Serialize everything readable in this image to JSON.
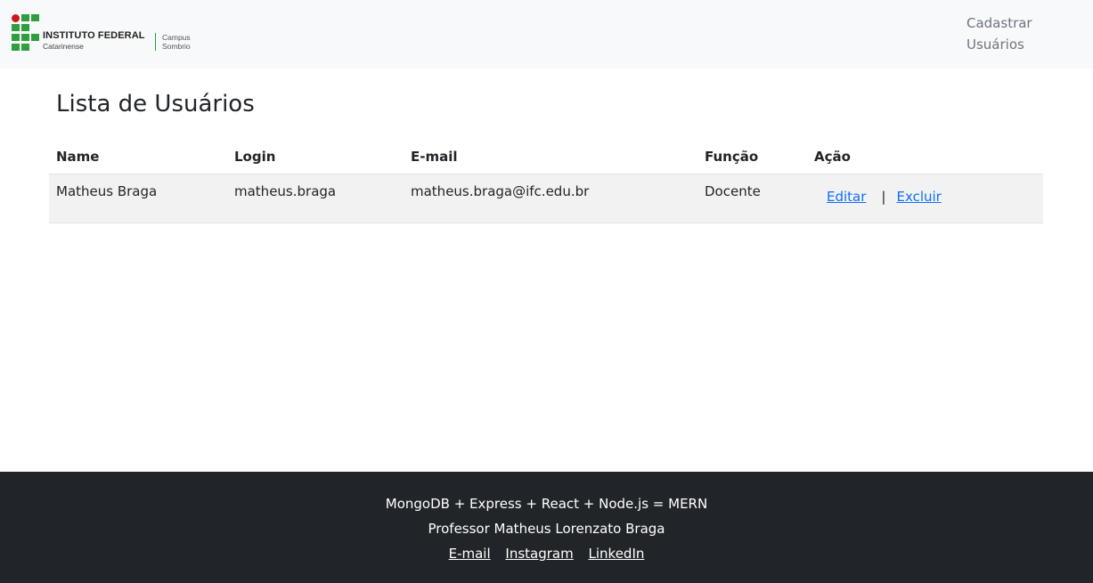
{
  "navbar": {
    "logo": {
      "name": "INSTITUTO FEDERAL",
      "subname": "Catarinense",
      "campus_line1": "Campus",
      "campus_line2": "Sombrio"
    },
    "nav_link_label": "Cadastrar Usuários"
  },
  "main": {
    "title": "Lista de Usuários",
    "table": {
      "headers": [
        "Name",
        "Login",
        "E-mail",
        "Função",
        "Ação"
      ],
      "rows": [
        {
          "name": "Matheus Braga",
          "login": "matheus.braga",
          "email": "matheus.braga@ifc.edu.br",
          "role": "Docente",
          "edit_label": "Editar",
          "separator": "|",
          "delete_label": "Excluir"
        }
      ]
    }
  },
  "footer": {
    "line1": "MongoDB + Express + React + Node.js = MERN",
    "line2": "Professor Matheus Lorenzato Braga",
    "links": [
      "E-mail",
      "Instagram",
      "LinkedIn"
    ]
  },
  "colors": {
    "navbar_bg": "#f8f9fa",
    "footer_bg": "#212529",
    "link": "#0d6efd",
    "logo_green": "#2f9e41",
    "logo_red": "#cd191e"
  }
}
